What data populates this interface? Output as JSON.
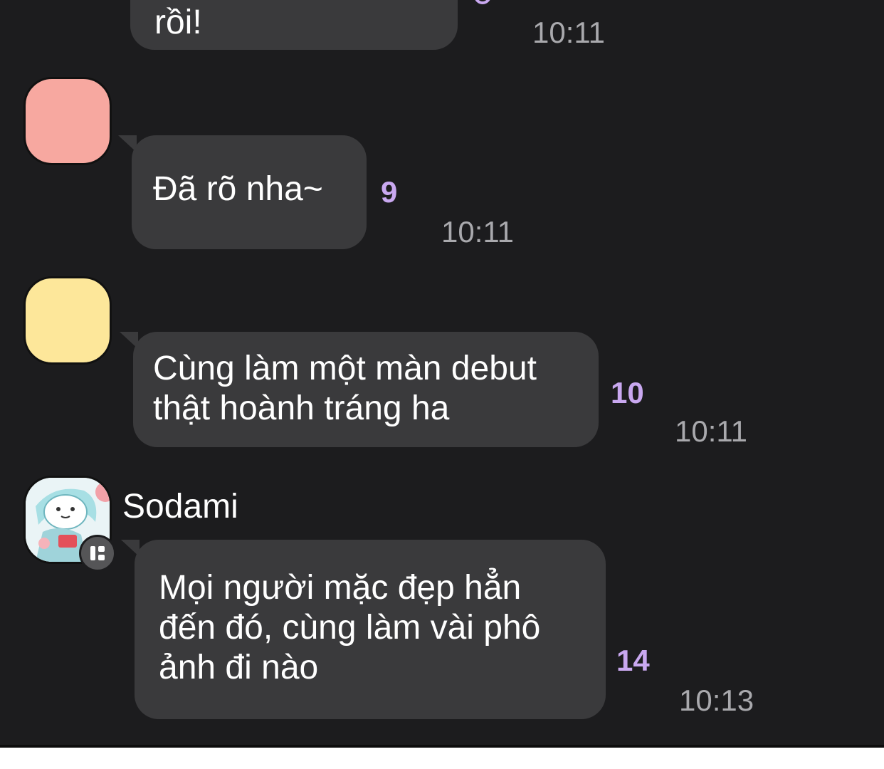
{
  "messages": [
    {
      "text": "rồi!",
      "read_count": "",
      "time": "10:11"
    },
    {
      "text": "Đã rõ nha~",
      "read_count": "9",
      "time": "10:11"
    },
    {
      "text": "Cùng làm một màn debut\nthật hoành tráng ha",
      "read_count": "10",
      "time": "10:11"
    },
    {
      "sender": "Sodami",
      "text": "Mọi người mặc đẹp hẳn\nđến đó, cùng làm vài phô\nảnh đi nào",
      "read_count": "14",
      "time": "10:13"
    }
  ],
  "colors": {
    "background": "#1c1c1e",
    "bubble": "#3a3a3c",
    "read_count": "#c9a8f0",
    "time": "#a9a9ad",
    "avatar_pink": "#f7a8a0",
    "avatar_yellow": "#fde79a"
  },
  "icons": {
    "avatar_sodami": "anime-character-avatar",
    "status_badge": "grid-badge-icon"
  }
}
